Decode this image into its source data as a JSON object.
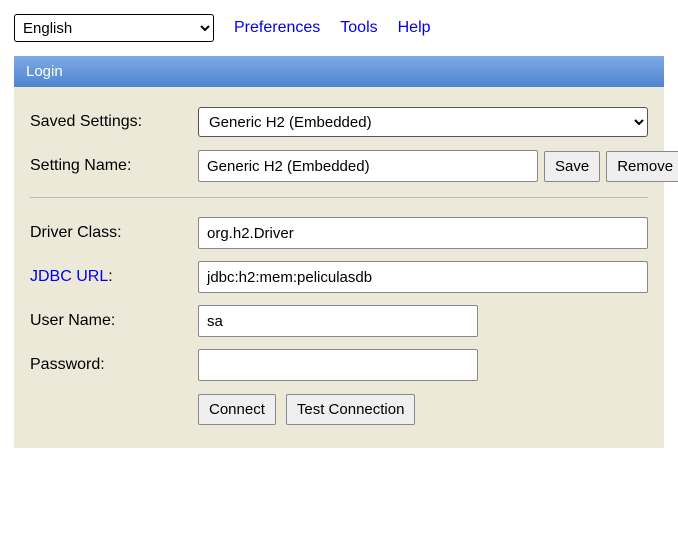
{
  "topbar": {
    "language_selected": "English",
    "links": {
      "preferences": "Preferences",
      "tools": "Tools",
      "help": "Help"
    }
  },
  "panel": {
    "title": "Login",
    "labels": {
      "saved_settings": "Saved Settings:",
      "setting_name": "Setting Name:",
      "driver_class": "Driver Class:",
      "jdbc_url": "JDBC URL",
      "jdbc_url_suffix": ":",
      "user_name": "User Name:",
      "password": "Password:"
    },
    "fields": {
      "saved_settings_selected": "Generic H2 (Embedded)",
      "setting_name": "Generic H2 (Embedded)",
      "driver_class": "org.h2.Driver",
      "jdbc_url": "jdbc:h2:mem:peliculasdb",
      "user_name": "sa",
      "password": ""
    },
    "buttons": {
      "save": "Save",
      "remove": "Remove",
      "connect": "Connect",
      "test_connection": "Test Connection"
    }
  }
}
